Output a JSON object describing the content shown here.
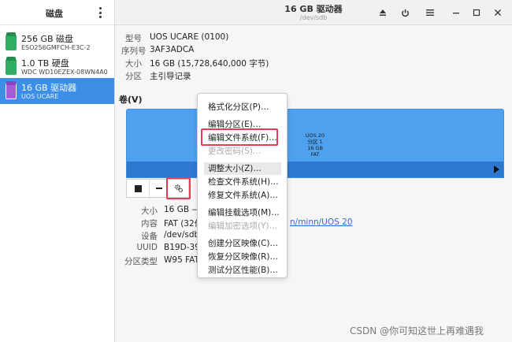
{
  "sidebar": {
    "title": "磁盘",
    "disks": [
      {
        "name": "256 GB 磁盘",
        "sub": "ESO256GMFCH-E3C-2",
        "color": "#2fae62"
      },
      {
        "name": "1.0 TB 硬盘",
        "sub": "WDC WD10EZEX-08WN4A0",
        "color": "#2fae62"
      },
      {
        "name": "16 GB 驱动器",
        "sub": "UOS UCARE",
        "color": "#a65bd6",
        "selected": true
      }
    ]
  },
  "window": {
    "title": "16 GB 驱动器",
    "subtitle": "/dev/sdb",
    "buttons": [
      "eject-icon",
      "power-icon",
      "menu-icon",
      "minimize-icon",
      "maximize-icon",
      "close-icon"
    ]
  },
  "properties": [
    {
      "label": "型号",
      "value": "UOS UCARE (0100)"
    },
    {
      "label": "序列号",
      "value": "3AF3ADCA"
    },
    {
      "label": "大小",
      "value": "16 GB (15,728,640,000 字节)"
    },
    {
      "label": "分区",
      "value": "主引导记录"
    }
  ],
  "volumes": {
    "title": "卷(V)",
    "partition_text": [
      "UOS 20",
      "分区 1",
      "16 GB FAT"
    ],
    "toolbar": [
      "stop-icon",
      "minus-icon",
      "gears-icon"
    ]
  },
  "details": [
    {
      "label": "大小",
      "value": "16 GB —"
    },
    {
      "label": "内容",
      "value": "FAT (32位"
    },
    {
      "label": "设备",
      "value": "/dev/sdb"
    },
    {
      "label": "UUID",
      "value": "B19D-39"
    },
    {
      "label": "分区类型",
      "value": "W95 FAT:"
    }
  ],
  "mount_link": "n/minn/UOS 20",
  "context_menu": [
    {
      "label": "格式化分区(P)…",
      "disabled": false
    },
    {
      "label": "编辑分区(E)…",
      "disabled": false
    },
    {
      "label": "编辑文件系统(F)…",
      "disabled": false
    },
    {
      "label": "更改密码(S)…",
      "disabled": true
    },
    {
      "label": "调整大小(Z)…",
      "disabled": false
    },
    {
      "label": "检查文件系统(H)…",
      "disabled": false
    },
    {
      "label": "修复文件系统(A)…",
      "disabled": false
    },
    {
      "label": "编辑挂载选项(M)…",
      "disabled": false
    },
    {
      "label": "编辑加密选项(Y)…",
      "disabled": true
    },
    {
      "label": "创建分区映像(C)…",
      "disabled": false
    },
    {
      "label": "恢复分区映像(R)…",
      "disabled": false
    },
    {
      "label": "测试分区性能(B)…",
      "disabled": false
    }
  ],
  "highlight_color": "#e63b56",
  "watermark": "CSDN @你可知这世上再难遇我"
}
